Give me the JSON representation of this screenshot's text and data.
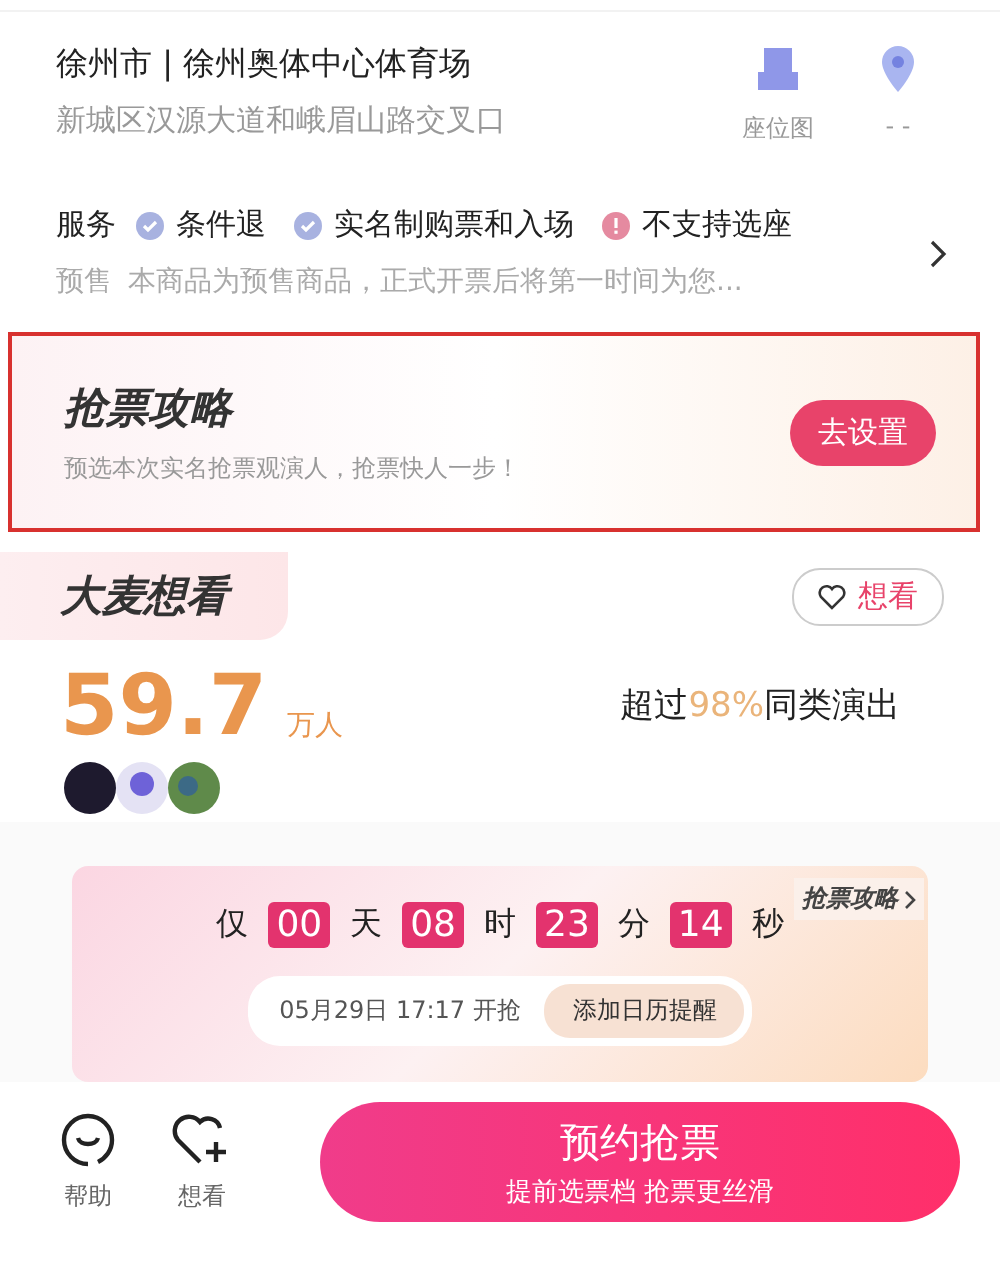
{
  "venue": {
    "name": "徐州市 | 徐州奥体中心体育场",
    "address": "新城区汉源大道和峨眉山路交叉口",
    "actions": [
      {
        "label": "座位图"
      },
      {
        "label": "- -"
      }
    ]
  },
  "services": {
    "label": "服务",
    "items": [
      {
        "text": "条件退",
        "kind": "check"
      },
      {
        "text": "实名制购票和入场",
        "kind": "check"
      },
      {
        "text": "不支持选座",
        "kind": "warn"
      }
    ],
    "presale_tag": "预售",
    "presale_text": "本商品为预售商品，正式开票后将第一时间为您..."
  },
  "strategy": {
    "title": "抢票攻略",
    "subtitle": "预选本次实名抢票观演人，抢票快人一步！",
    "button": "去设置"
  },
  "wants": {
    "title": "大麦想看",
    "follow_button": "想看",
    "count": "59.7",
    "unit": "万人",
    "compare_before": "超过",
    "compare_pct": "98%",
    "compare_after": "同类演出"
  },
  "countdown": {
    "prefix": "仅",
    "units": [
      {
        "value": "00",
        "unit": "天"
      },
      {
        "value": "08",
        "unit": "时"
      },
      {
        "value": "23",
        "unit": "分"
      },
      {
        "value": "14",
        "unit": "秒"
      }
    ],
    "corner_link": "抢票攻略",
    "start_time": "05月29日 17:17 开抢",
    "calendar_button": "添加日历提醒"
  },
  "bottom_bar": {
    "icons": [
      {
        "label": "帮助",
        "kind": "help"
      },
      {
        "label": "想看",
        "kind": "want"
      }
    ],
    "main_button": "预约抢票",
    "main_sub": "提前选票档 抢票更丝滑"
  }
}
